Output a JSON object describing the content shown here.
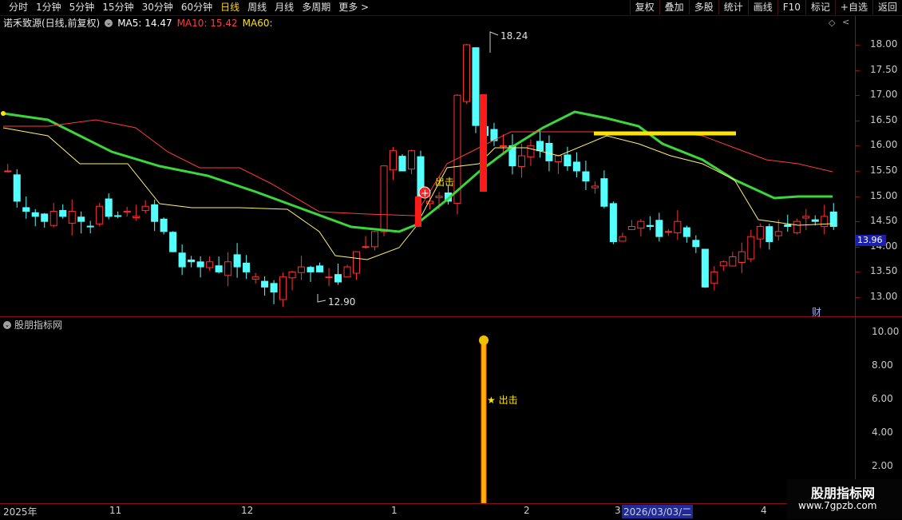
{
  "periods": [
    "分时",
    "1分钟",
    "5分钟",
    "15分钟",
    "30分钟",
    "60分钟",
    "日线",
    "周线",
    "月线",
    "多周期",
    "更多 >"
  ],
  "active_period": "日线",
  "right_buttons": [
    "复权",
    "叠加",
    "多股",
    "统计",
    "画线",
    "F10",
    "标记",
    "+自选",
    "返回"
  ],
  "stock": {
    "name": "诺禾致源(日线,前复权)",
    "ma5": "MA5: 14.47",
    "ma10": "MA10: 15.42",
    "ma60": "MA60:"
  },
  "price_axis": [
    "18.00",
    "17.50",
    "17.00",
    "16.50",
    "16.00",
    "15.50",
    "15.00",
    "14.50",
    "14.00",
    "13.50",
    "13.00"
  ],
  "current_price": "13.96",
  "high_label": "18.24",
  "low_label": "12.90",
  "signal_label": "出击",
  "panel2": {
    "title": "股朋指标网",
    "axis": [
      "10.00",
      "8.00",
      "6.00",
      "4.00",
      "2.00"
    ],
    "star_label": "★ 出击"
  },
  "fin_label": "财",
  "dates": [
    "2025年",
    "11",
    "12",
    "1",
    "2",
    "3",
    "2026/03/03/二",
    "4"
  ],
  "watermark": {
    "line1": "股朋指标网",
    "line2": "www.7gpzb.com"
  },
  "colors": {
    "up": "#ff3232",
    "down": "#54ffff",
    "ma5": "#ffffff",
    "ma10": "#ff3b3b",
    "ma60": "#3bd63b",
    "highlight": "#ffe400"
  }
}
